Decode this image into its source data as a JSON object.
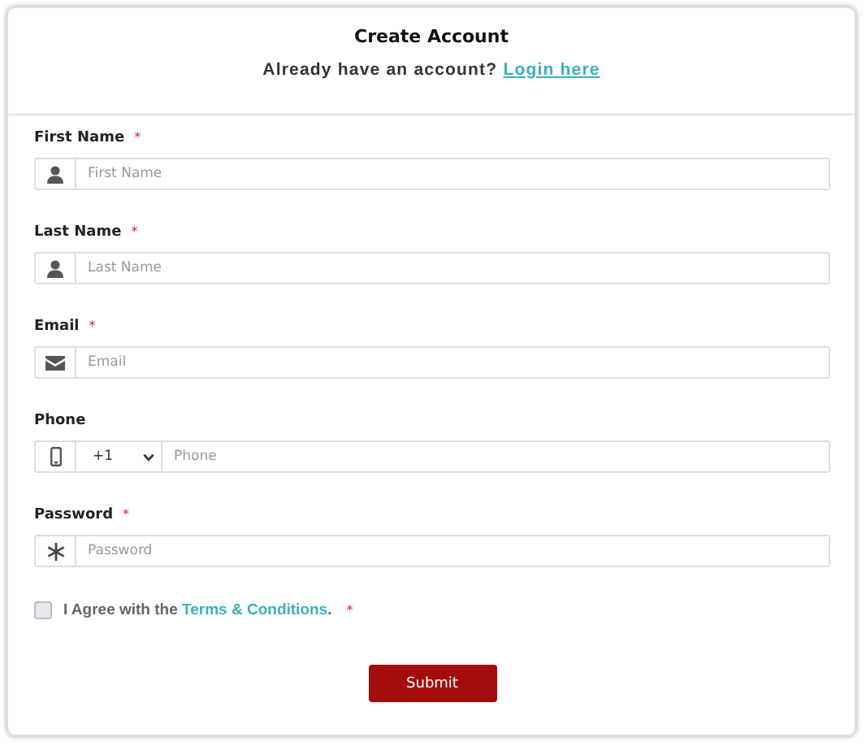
{
  "header": {
    "title": "Create Account",
    "prompt": "Already have an account?",
    "login_link": "Login here"
  },
  "fields": [
    {
      "label": "First Name",
      "required_mark": "*",
      "kind": "person",
      "placeholder": "First Name"
    },
    {
      "label": "Last Name",
      "required_mark": "*",
      "kind": "person",
      "placeholder": "Last Name"
    },
    {
      "label": "Email",
      "required_mark": "*",
      "kind": "email",
      "placeholder": "Email"
    },
    {
      "label": "Phone",
      "kind": "phone",
      "country_code": "+1",
      "placeholder": "Phone"
    },
    {
      "label": "Password",
      "required_mark": "*",
      "kind": "password",
      "placeholder": "Password"
    }
  ],
  "agree": {
    "checked": false,
    "text": "I Agree with the",
    "link": "Terms & Conditions",
    "end": ".",
    "required_mark": "*"
  },
  "submit": "Submit"
}
